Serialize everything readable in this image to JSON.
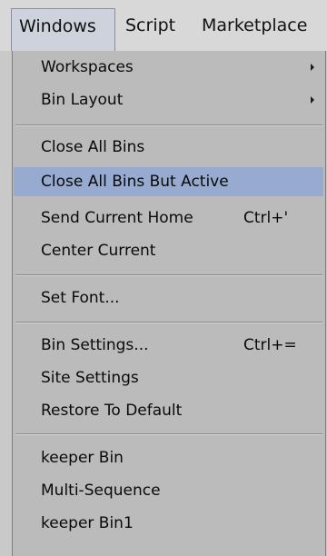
{
  "menubar": {
    "items": [
      "Windows",
      "Script",
      "Marketplace"
    ]
  },
  "menu": {
    "groups": [
      [
        {
          "label": "Workspaces",
          "submenu": true
        },
        {
          "label": "Bin Layout",
          "submenu": true
        }
      ],
      [
        {
          "label": "Close All Bins"
        },
        {
          "label": "Close All Bins But Active",
          "highlighted": true
        },
        {
          "label": "Send Current Home",
          "shortcut": "Ctrl+'"
        },
        {
          "label": "Center Current"
        }
      ],
      [
        {
          "label": "Set Font..."
        }
      ],
      [
        {
          "label": "Bin Settings...",
          "shortcut": "Ctrl+="
        },
        {
          "label": "Site Settings"
        },
        {
          "label": "Restore To Default"
        }
      ],
      [
        {
          "label": "keeper Bin"
        },
        {
          "label": "Multi-Sequence"
        },
        {
          "label": "keeper Bin1"
        }
      ]
    ]
  },
  "colors": {
    "menu_background": "#bbbbbb",
    "highlight": "#97abd0",
    "menubar_background": "#d8d8d8"
  }
}
